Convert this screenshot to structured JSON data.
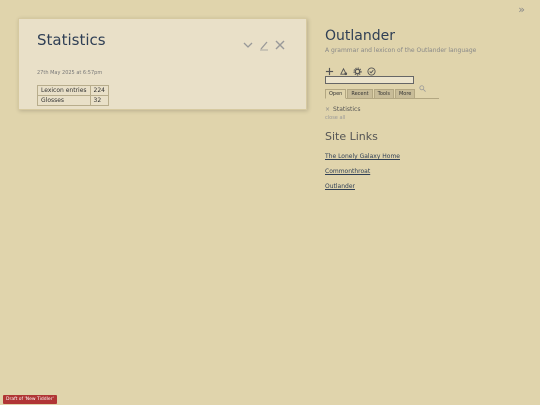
{
  "topbar": {
    "toggle_icon": "chevron-double-right-icon",
    "toggle_glyph": "»"
  },
  "tiddler": {
    "title": "Statistics",
    "subtitle": "27th May 2025 at 6:57pm",
    "controls": [
      "chevron-down-icon",
      "edit-icon",
      "close-icon"
    ],
    "rows": [
      {
        "label": "Lexicon entries",
        "value": "224"
      },
      {
        "label": "Glosses",
        "value": "32"
      }
    ]
  },
  "sidebar": {
    "title": "Outlander",
    "subtitle": "A grammar and lexicon of the Outlander language",
    "page_controls": [
      "new-tiddler-icon",
      "import-icon",
      "settings-icon",
      "check-icon"
    ],
    "search": {
      "value": "",
      "placeholder": ""
    },
    "tabs": [
      "Open",
      "Recent",
      "Tools",
      "More"
    ],
    "active_tab": "Open",
    "open_items": [
      {
        "label": "Statistics"
      }
    ],
    "close_all": "close all",
    "links_heading": "Site Links",
    "links": [
      "The Lonely Galaxy Home",
      "Commonthroat",
      "Outlander"
    ]
  },
  "draft_badge": "Draft of 'New Tiddler'",
  "colors": {
    "background": "#e0d4ac",
    "title": "#2f3f55",
    "badge": "#b03535"
  }
}
